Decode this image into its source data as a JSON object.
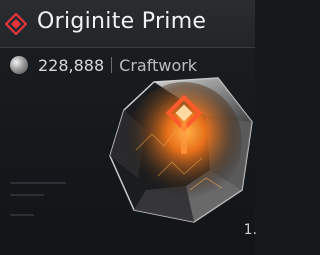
{
  "item": {
    "name": "Originite Prime",
    "count": "228,888",
    "category": "Craftwork",
    "corner_value": "1."
  },
  "icons": {
    "rarity": "diamond-rarity-icon",
    "currency": "orb-icon",
    "item_image": "originite-prime-crystal"
  },
  "colors": {
    "rarity_red": "#e2343c",
    "glow_orange": "#ff7a1a"
  }
}
